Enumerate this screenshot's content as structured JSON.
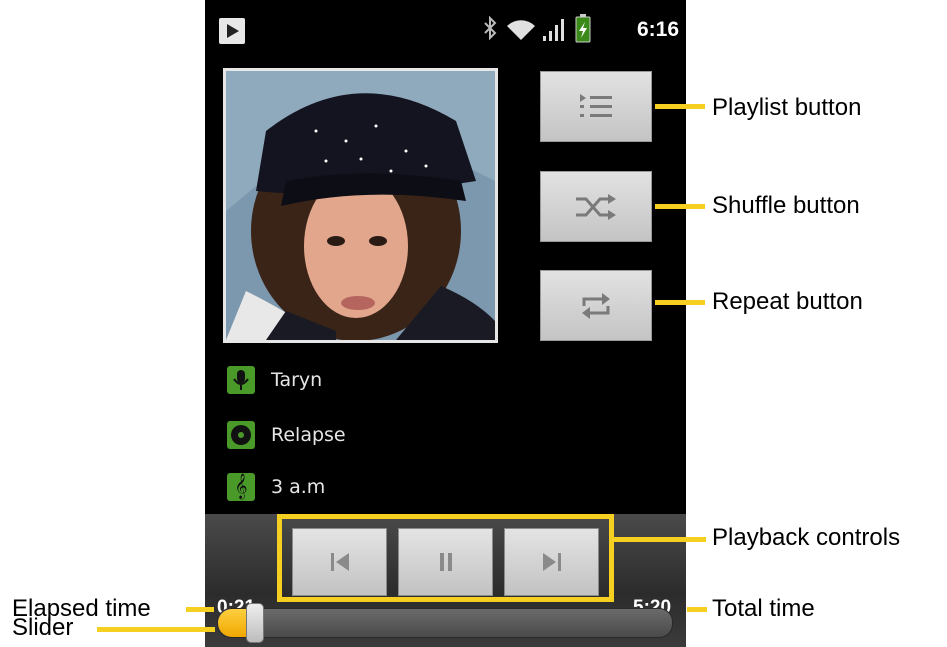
{
  "status_bar": {
    "time": "6:16"
  },
  "album_art": {
    "description": "album-cover"
  },
  "side_buttons": {
    "playlist": {
      "icon": "playlist-icon"
    },
    "shuffle": {
      "icon": "shuffle-icon"
    },
    "repeat": {
      "icon": "repeat-icon"
    }
  },
  "track": {
    "artist": "Taryn",
    "album": "Relapse",
    "title": "3 a.m"
  },
  "playback": {
    "elapsed": "0:21",
    "total": "5:20",
    "progress_fraction": 0.066
  },
  "callouts": {
    "playlist": "Playlist button",
    "shuffle": "Shuffle button",
    "repeat": "Repeat button",
    "playback_controls": "Playback controls",
    "elapsed": "Elapsed time",
    "total": "Total time",
    "slider": "Slider"
  },
  "colors": {
    "highlight": "#f5d021",
    "accent_green": "#4a9a2a",
    "slider_fill": "#f0a800"
  }
}
